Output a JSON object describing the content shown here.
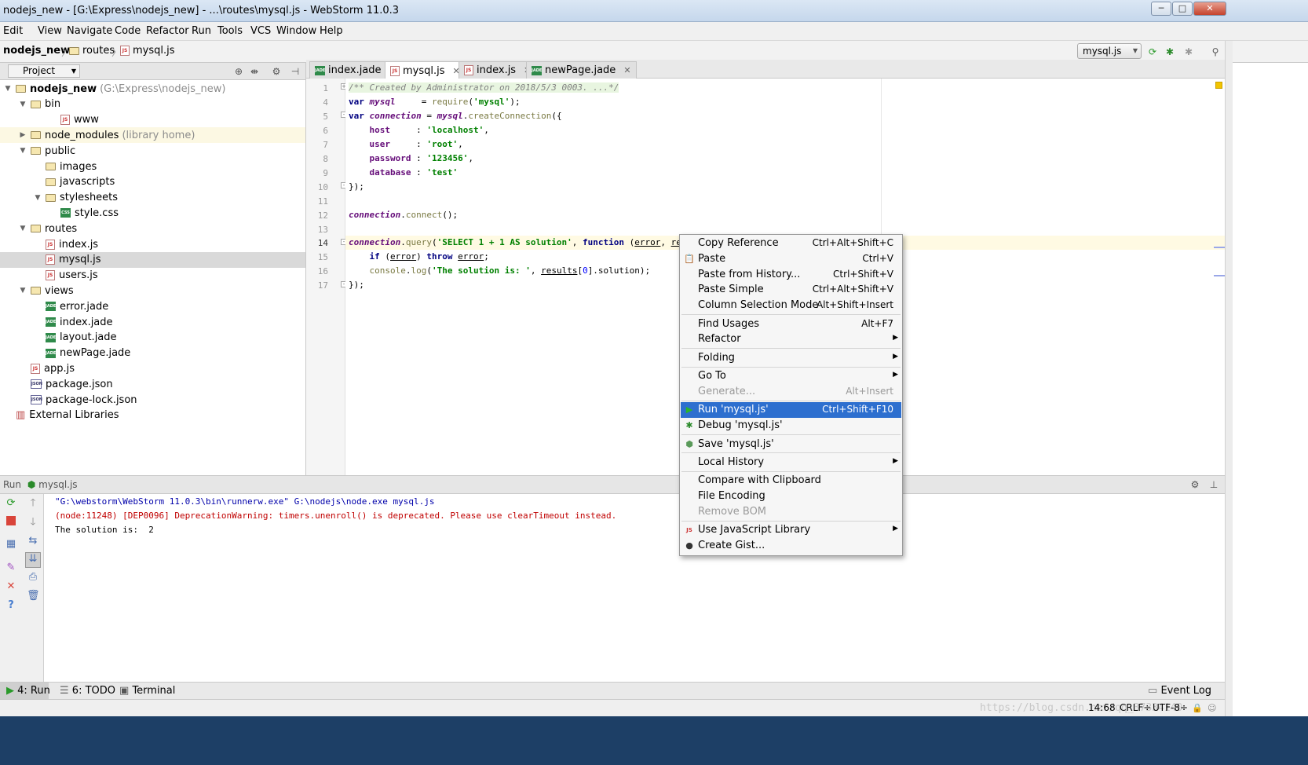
{
  "window": {
    "title": "nodejs_new - [G:\\Express\\nodejs_new] - ...\\routes\\mysql.js - WebStorm 11.0.3",
    "buttons": [
      "─",
      "□",
      "✕"
    ]
  },
  "menu": [
    "Edit",
    "View",
    "Navigate",
    "Code",
    "Refactor",
    "Run",
    "Tools",
    "VCS",
    "Window",
    "Help"
  ],
  "breadcrumb": {
    "project": "nodejs_new",
    "folder": "routes",
    "file": "mysql.js"
  },
  "run_config": {
    "label": "mysql.js"
  },
  "project_panel": {
    "title": "Project",
    "tree": [
      {
        "label": "nodejs_new",
        "extra": "(G:\\Express\\nodejs_new)",
        "icon": "folder",
        "arrow": "▼",
        "level": 0,
        "bold": true
      },
      {
        "label": "bin",
        "icon": "folder",
        "arrow": "▼",
        "level": 1
      },
      {
        "label": "www",
        "icon": "js",
        "arrow": "",
        "level": 3
      },
      {
        "label": "node_modules",
        "extra": "(library home)",
        "icon": "folder",
        "arrow": "▶",
        "level": 1,
        "highlight": true
      },
      {
        "label": "public",
        "icon": "folder",
        "arrow": "▼",
        "level": 1
      },
      {
        "label": "images",
        "icon": "folder",
        "arrow": "",
        "level": 2
      },
      {
        "label": "javascripts",
        "icon": "folder",
        "arrow": "",
        "level": 2
      },
      {
        "label": "stylesheets",
        "icon": "folder",
        "arrow": "▼",
        "level": 2
      },
      {
        "label": "style.css",
        "icon": "css",
        "arrow": "",
        "level": 3
      },
      {
        "label": "routes",
        "icon": "folder",
        "arrow": "▼",
        "level": 1
      },
      {
        "label": "index.js",
        "icon": "js",
        "arrow": "",
        "level": 2
      },
      {
        "label": "mysql.js",
        "icon": "js",
        "arrow": "",
        "level": 2,
        "selected": true
      },
      {
        "label": "users.js",
        "icon": "js",
        "arrow": "",
        "level": 2
      },
      {
        "label": "views",
        "icon": "folder",
        "arrow": "▼",
        "level": 1
      },
      {
        "label": "error.jade",
        "icon": "jade",
        "arrow": "",
        "level": 2
      },
      {
        "label": "index.jade",
        "icon": "jade",
        "arrow": "",
        "level": 2
      },
      {
        "label": "layout.jade",
        "icon": "jade",
        "arrow": "",
        "level": 2
      },
      {
        "label": "newPage.jade",
        "icon": "jade",
        "arrow": "",
        "level": 2
      },
      {
        "label": "app.js",
        "icon": "js",
        "arrow": "",
        "level": 1
      },
      {
        "label": "package.json",
        "icon": "json",
        "arrow": "",
        "level": 1
      },
      {
        "label": "package-lock.json",
        "icon": "json",
        "arrow": "",
        "level": 1
      },
      {
        "label": "External Libraries",
        "icon": "lib",
        "arrow": "",
        "level": 0
      }
    ]
  },
  "tabs": [
    {
      "label": "index.jade",
      "icon": "jade",
      "active": false
    },
    {
      "label": "mysql.js",
      "icon": "js",
      "active": true
    },
    {
      "label": "index.js",
      "icon": "js",
      "active": false
    },
    {
      "label": "newPage.jade",
      "icon": "jade",
      "active": false
    }
  ],
  "editor": {
    "line_numbers": [
      "1",
      "4",
      "5",
      "6",
      "7",
      "8",
      "9",
      "10",
      "11",
      "12",
      "13",
      "14",
      "15",
      "16",
      "17"
    ],
    "current_line": "14"
  },
  "context_menu": {
    "items": [
      {
        "type": "item",
        "label": "Copy Reference",
        "shortcut": "Ctrl+Alt+Shift+C"
      },
      {
        "type": "item",
        "label": "Paste",
        "shortcut": "Ctrl+V",
        "icon": "paste-icon"
      },
      {
        "type": "item",
        "label": "Paste from History...",
        "shortcut": "Ctrl+Shift+V"
      },
      {
        "type": "item",
        "label": "Paste Simple",
        "shortcut": "Ctrl+Alt+Shift+V"
      },
      {
        "type": "item",
        "label": "Column Selection Mode",
        "shortcut": "Alt+Shift+Insert"
      },
      {
        "type": "sep"
      },
      {
        "type": "item",
        "label": "Find Usages",
        "shortcut": "Alt+F7"
      },
      {
        "type": "item",
        "label": "Refactor",
        "submenu": true
      },
      {
        "type": "sep"
      },
      {
        "type": "item",
        "label": "Folding",
        "submenu": true
      },
      {
        "type": "sep"
      },
      {
        "type": "item",
        "label": "Go To",
        "submenu": true
      },
      {
        "type": "item",
        "label": "Generate...",
        "shortcut": "Alt+Insert",
        "disabled": true
      },
      {
        "type": "sep"
      },
      {
        "type": "item",
        "label": "Run 'mysql.js'",
        "shortcut": "Ctrl+Shift+F10",
        "icon": "run-icon",
        "selected": true
      },
      {
        "type": "item",
        "label": "Debug 'mysql.js'",
        "icon": "debug-icon"
      },
      {
        "type": "sep"
      },
      {
        "type": "item",
        "label": "Save 'mysql.js'",
        "icon": "save-icon"
      },
      {
        "type": "sep"
      },
      {
        "type": "item",
        "label": "Local History",
        "submenu": true
      },
      {
        "type": "sep"
      },
      {
        "type": "item",
        "label": "Compare with Clipboard"
      },
      {
        "type": "item",
        "label": "File Encoding"
      },
      {
        "type": "item",
        "label": "Remove BOM",
        "disabled": true
      },
      {
        "type": "sep"
      },
      {
        "type": "item",
        "label": "Use JavaScript Library",
        "submenu": true,
        "icon": "js-library-icon"
      },
      {
        "type": "item",
        "label": "Create Gist...",
        "icon": "github-icon"
      }
    ]
  },
  "run_panel": {
    "title": "Run",
    "config": "mysql.js",
    "console": [
      {
        "text": "\"G:\\webstorm\\WebStorm 11.0.3\\bin\\runnerw.exe\" G:\\nodejs\\node.exe mysql.js",
        "color": "#0000aa"
      },
      {
        "text": "(node:11248) [DEP0096] DeprecationWarning: timers.unenroll() is deprecated. Please use clearTimeout instead.",
        "color": "#c00000"
      },
      {
        "text": "The solution is:  2",
        "color": "#000000"
      }
    ]
  },
  "tool_windows": [
    {
      "label": "4: Run",
      "icon": "run-icon",
      "active": true
    },
    {
      "label": "6: TODO",
      "icon": "todo-icon"
    },
    {
      "label": "Terminal",
      "icon": "terminal-icon"
    }
  ],
  "event_log": "Event Log",
  "status": {
    "position": "14:68",
    "line_sep": "CRLF÷",
    "encoding": "UTF-8÷"
  },
  "watermark": "https://blog.csdn.net/qq_37334140",
  "colors": {
    "selection": "#2d6fcf",
    "keyword": "#000080",
    "string": "#008000",
    "error": "#c00000"
  }
}
